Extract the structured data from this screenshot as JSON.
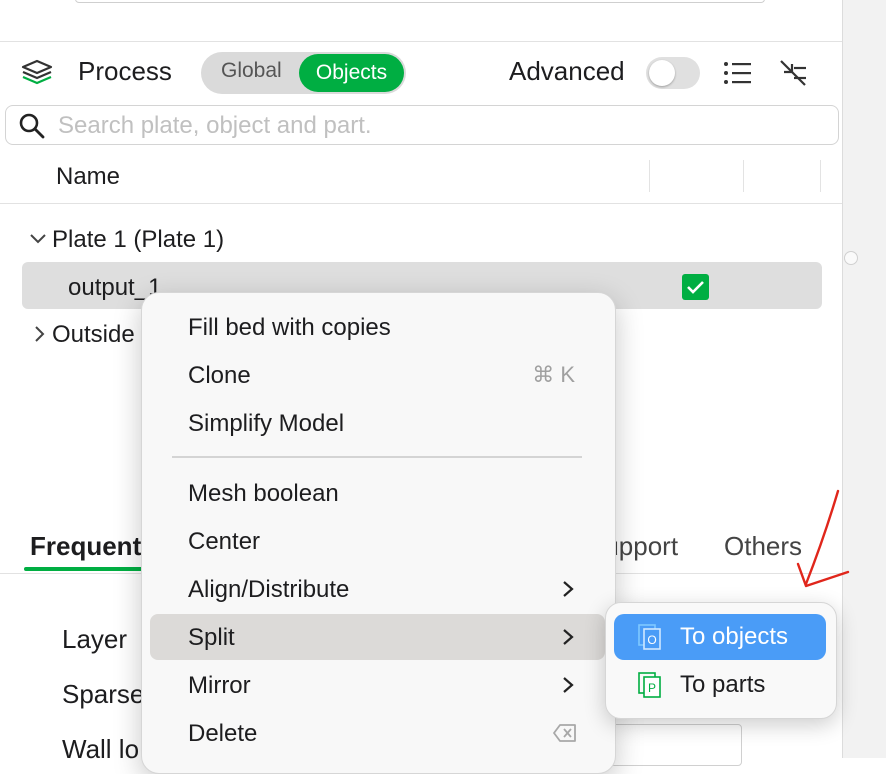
{
  "header": {
    "process_label": "Process",
    "mode_global": "Global",
    "mode_objects": "Objects",
    "advanced_label": "Advanced"
  },
  "search": {
    "placeholder": "Search plate, object and part."
  },
  "table": {
    "column_name": "Name"
  },
  "tree": {
    "plate": "Plate 1 (Plate 1)",
    "object": "output_1",
    "outside": "Outside"
  },
  "tabs": {
    "frequent": "Frequent",
    "support": "Support",
    "others": "Others"
  },
  "params": {
    "layer": "Layer",
    "sparse": "Sparse",
    "wall": "Wall lo"
  },
  "context_menu": {
    "items": [
      {
        "label": "Fill bed with copies"
      },
      {
        "label": "Clone",
        "shortcut": "⌘ K"
      },
      {
        "label": "Simplify Model"
      },
      {
        "label": "Mesh boolean"
      },
      {
        "label": "Center"
      },
      {
        "label": "Align/Distribute"
      },
      {
        "label": "Split"
      },
      {
        "label": "Mirror"
      },
      {
        "label": "Delete"
      }
    ]
  },
  "submenu": {
    "items": [
      {
        "label": "To objects",
        "icon_letter": "O"
      },
      {
        "label": "To parts",
        "icon_letter": "P"
      }
    ]
  },
  "colors": {
    "accent_green": "#00ae42",
    "highlight_blue": "#4a9cf7",
    "annotation_red": "#e0261b"
  }
}
